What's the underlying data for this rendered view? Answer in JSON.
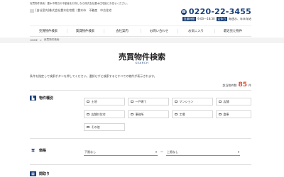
{
  "header": {
    "top_note": "売買物件検索｜豊木市周辺の不動産をお探しなら株式会社豊木住宅館にお任せください。",
    "logo_text": "[自社案内]株式会社豊木住宅館｜豊木市　不動産　中古住宅",
    "phone": "0220-22-3455",
    "hours_badge": "営業時間",
    "hours_text": "9:00～18:30",
    "holiday_badge": "定休日",
    "holiday_text": "毎週水、年末年始"
  },
  "nav": {
    "items": [
      "売買物件検索",
      "賃貸物件検索",
      "会社案内",
      "お問い合わせ",
      "お気に入り",
      "最近見た物件"
    ]
  },
  "breadcrumb": {
    "home": "HOME",
    "sep": ">",
    "current": "売買物件検索"
  },
  "page": {
    "title": "売買物件検索",
    "subtitle": "SEARCH",
    "description": "条件を指定して検索ボタンを押してください。選択せずに検索するとすべての物件が表示されます。",
    "count_label": "該当物件数",
    "count": "85",
    "count_unit": "件"
  },
  "filters": {
    "type_label": "物件種別",
    "type_options": [
      "土地",
      "一戸建て",
      "マンション",
      "店舗",
      "店舗付住宅",
      "事務所",
      "工場",
      "倉庫",
      "その他"
    ],
    "price_label": "価格",
    "price_min": "下限なし",
    "price_sep": "～",
    "price_max": "上限なし",
    "next_label": "間取り"
  },
  "colors": {
    "accent": "#1a3f7a",
    "count": "#e04b2e"
  }
}
